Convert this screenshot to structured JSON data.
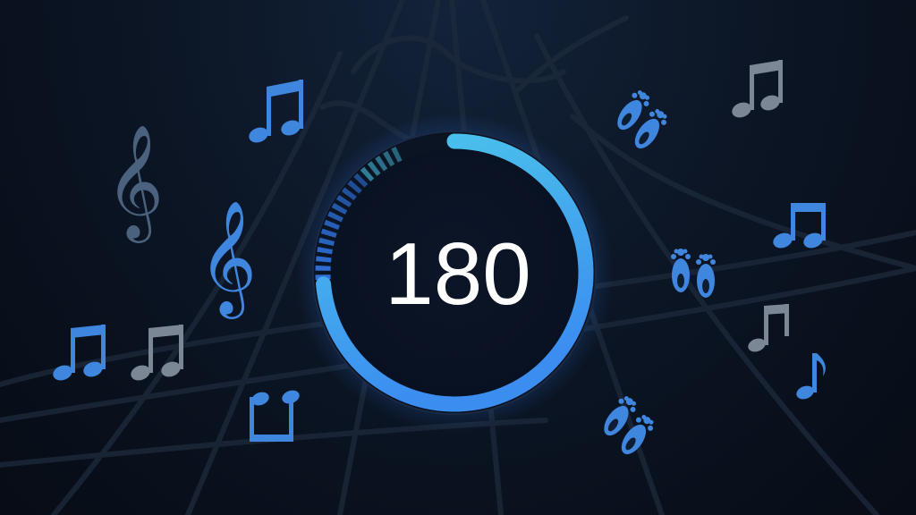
{
  "screen": {
    "cadence_value": "180",
    "cadence_fill_fraction": 0.93,
    "colors": {
      "background": "#0a1220",
      "ring_start": "#3b8df0",
      "ring_end": "#4cc6ea",
      "ring_dash": "#2e6fd6",
      "track": "#0b1422",
      "icon_blue": "#3f86df",
      "icon_gray": "#7c8796",
      "text": "#ffffff"
    },
    "decorations": {
      "music_icons": [
        "eighth-notes-icon",
        "treble-clef-icon",
        "eighth-note-icon"
      ],
      "footprint_icons": [
        "footprints-icon"
      ]
    }
  }
}
